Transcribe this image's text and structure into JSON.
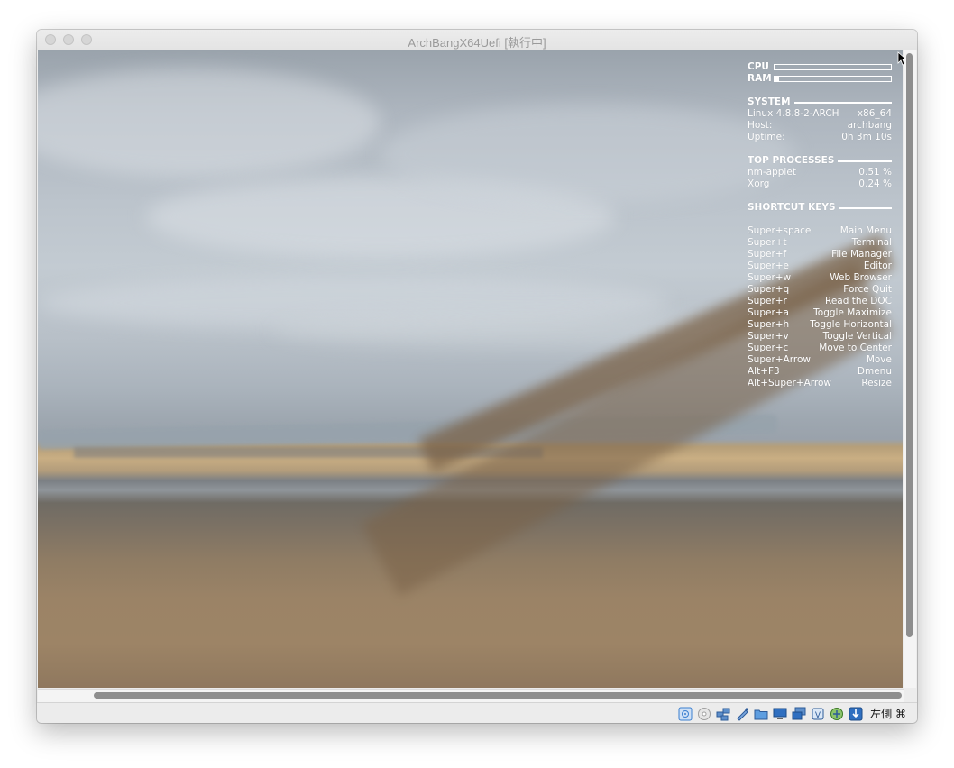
{
  "window": {
    "title": "ArchBangX64Uefi [執行中]"
  },
  "conky": {
    "cpu_label": "CPU",
    "cpu_usage_fraction": 0.0,
    "ram_label": "RAM",
    "ram_usage_fraction": 0.04,
    "system": {
      "header": "SYSTEM",
      "kernel": "Linux 4.8.8-2-ARCH",
      "arch": "x86_64",
      "host_label": "Host:",
      "host_value": "archbang",
      "uptime_label": "Uptime:",
      "uptime_value": "0h 3m 10s"
    },
    "top_processes": {
      "header": "TOP PROCESSES",
      "items": [
        {
          "name": "nm-applet",
          "value": "0.51 %"
        },
        {
          "name": "Xorg",
          "value": "0.24 %"
        }
      ]
    },
    "shortcuts": {
      "header": "SHORTCUT KEYS",
      "items": [
        {
          "key": "Super+space",
          "action": "Main Menu"
        },
        {
          "key": "Super+t",
          "action": "Terminal"
        },
        {
          "key": "Super+f",
          "action": "File Manager"
        },
        {
          "key": "Super+e",
          "action": "Editor"
        },
        {
          "key": "Super+w",
          "action": "Web Browser"
        },
        {
          "key": "Super+q",
          "action": "Force Quit"
        },
        {
          "key": "Super+r",
          "action": "Read the DOC"
        },
        {
          "key": "Super+a",
          "action": "Toggle Maximize"
        },
        {
          "key": "Super+h",
          "action": "Toggle Horizontal"
        },
        {
          "key": "Super+v",
          "action": "Toggle Vertical"
        },
        {
          "key": "Super+c",
          "action": "Move to Center"
        },
        {
          "key": "Super+Arrow",
          "action": "Move"
        },
        {
          "key": "Alt+F3",
          "action": "Dmenu"
        },
        {
          "key": "Alt+Super+Arrow",
          "action": "Resize"
        }
      ]
    }
  },
  "statusbar": {
    "icons": [
      "hard-disk-icon",
      "optical-drive-icon",
      "network-icon",
      "usb-icon",
      "shared-folder-icon",
      "display-icon",
      "video-capture-icon",
      "cpu-icon",
      "mouse-integration-icon",
      "keyboard-icon"
    ],
    "host_key": "左側 ⌘"
  },
  "colors": {
    "accent_blue": "#3b7fd0",
    "text_white": "#ffffff"
  }
}
